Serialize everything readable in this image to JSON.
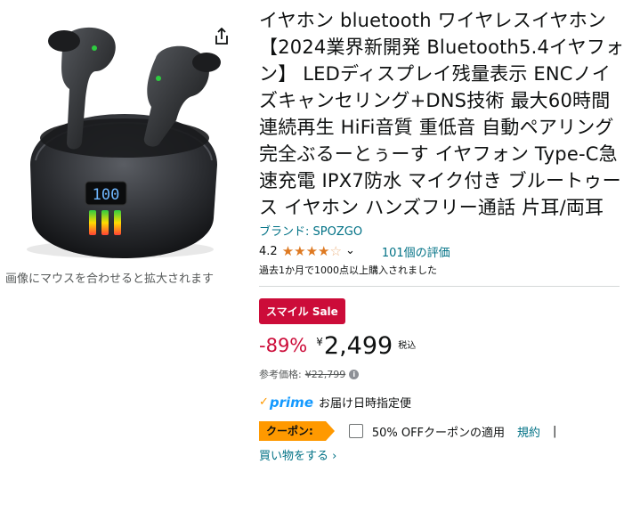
{
  "image": {
    "zoom_hint": "画像にマウスを合わせると拡大されます",
    "display_digits": "100"
  },
  "product": {
    "title": "イヤホン bluetooth ワイヤレスイヤホン 【2024業界新開発 Bluetooth5.4イヤフォン】 LEDディスプレイ残量表示 ENCノイズキャンセリング+DNS技術 最大60時間連続再生 HiFi音質 重低音 自動ペアリング 完全ぶるーとぅーす イヤフォン Type-C急速充電 IPX7防水 マイク付き ブルートゥース イヤホン ハンズフリー通話 片耳/両耳",
    "brand": "ブランド: SPOZGO"
  },
  "rating": {
    "value": "4.2",
    "stars": 4.2,
    "review_count": "101個の評価",
    "bought": "過去1か月で1000点以上購入されました"
  },
  "price": {
    "badge": "スマイル Sale",
    "discount": "-89%",
    "currency": "¥",
    "amount": "2,499",
    "tax": "税込",
    "ref_label": "参考価格:",
    "ref_price": "¥22,799"
  },
  "prime": {
    "logo": "prime",
    "delivery": "お届け日時指定便"
  },
  "coupon": {
    "tag": "クーポン:",
    "text": "50% OFFクーポンの適用",
    "terms": "規約",
    "separator": "|",
    "shop": "買い物をする ›"
  },
  "colors": {
    "link": "#007185",
    "sale": "#cc0c39",
    "star": "#de7921",
    "coupon": "#ff9900",
    "prime": "#1399ff"
  },
  "icons": [
    "share-icon",
    "star-icon",
    "chevron-down-icon",
    "info-icon",
    "prime-check-icon"
  ]
}
